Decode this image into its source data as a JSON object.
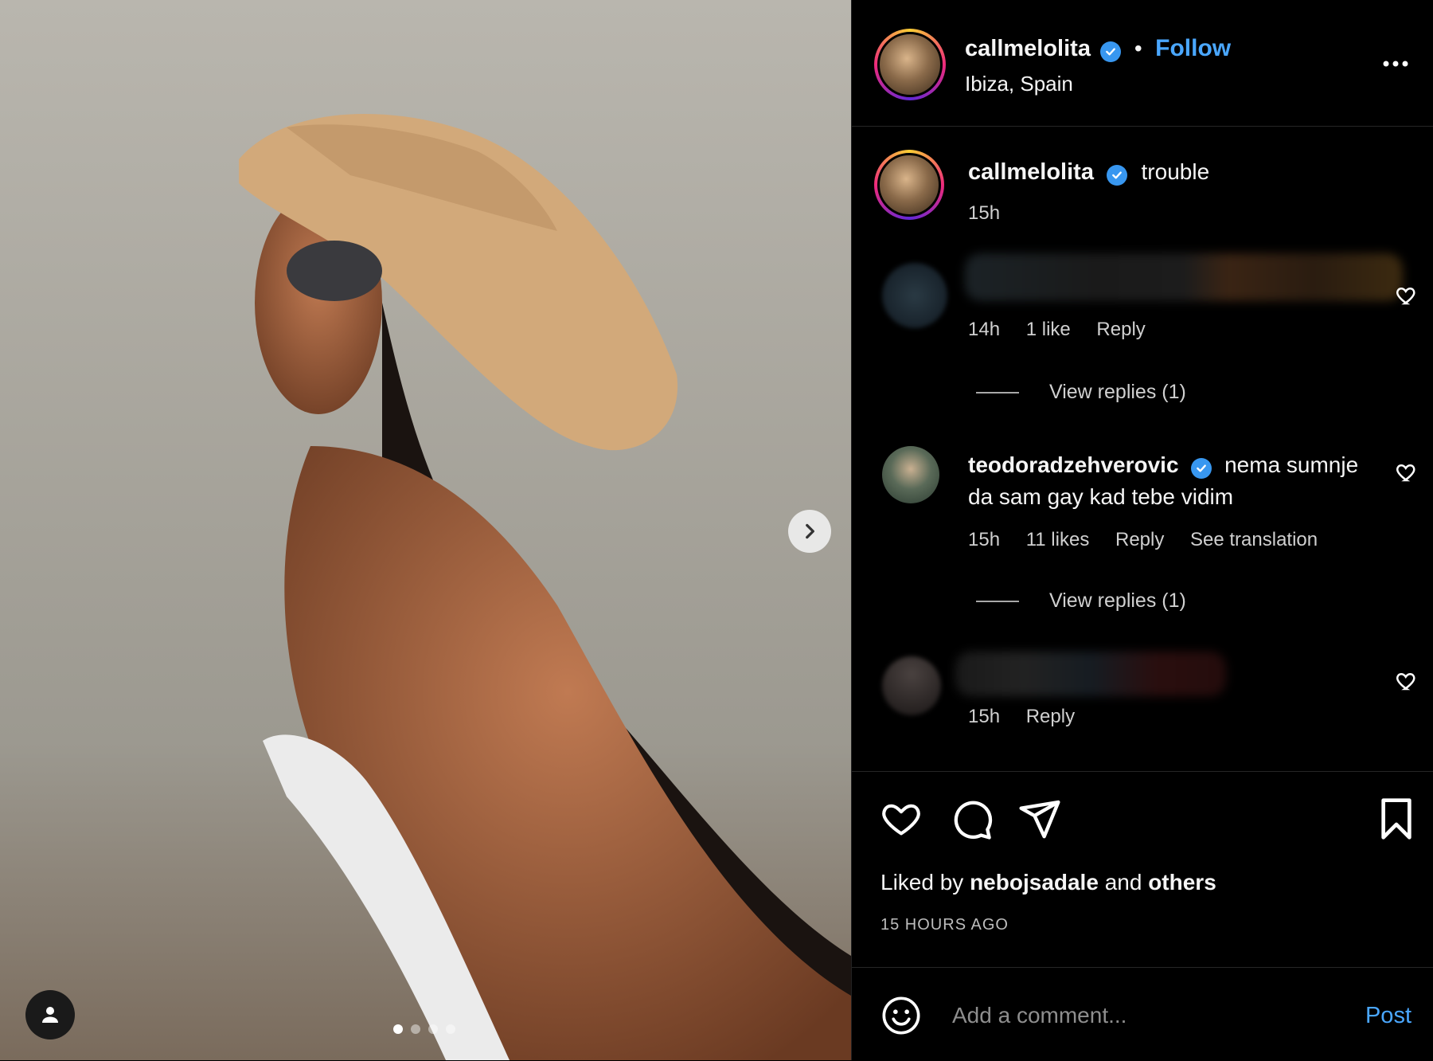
{
  "colors": {
    "accent": "#4aa7ff",
    "verified": "#3897f0",
    "background": "#000000",
    "secondary_text": "#d0d0d0"
  },
  "header": {
    "username": "callmelolita",
    "separator": "•",
    "follow_label": "Follow",
    "location": "Ibiza, Spain",
    "more_icon": "more-horizontal-icon"
  },
  "caption": {
    "username": "callmelolita",
    "text": "trouble",
    "time": "15h"
  },
  "comments": [
    {
      "username_blurred": true,
      "time": "14h",
      "likes": "1 like",
      "reply_label": "Reply",
      "view_replies": "View replies (1)"
    },
    {
      "username": "teodoradzehverovic",
      "text": "nema sumnje da sam gay kad tebe vidim",
      "time": "15h",
      "likes": "11 likes",
      "reply_label": "Reply",
      "translation_label": "See translation",
      "view_replies": "View replies (1)"
    },
    {
      "username_blurred": true,
      "time": "15h",
      "reply_label": "Reply"
    }
  ],
  "post": {
    "liked_prefix": "Liked by",
    "liked_user": "nebojsadale",
    "liked_mid": "and",
    "liked_others": "others",
    "time_ago": "15 HOURS AGO"
  },
  "composer": {
    "placeholder": "Add a comment...",
    "post_label": "Post"
  },
  "carousel": {
    "slide_count": 4,
    "active_index": 0
  }
}
